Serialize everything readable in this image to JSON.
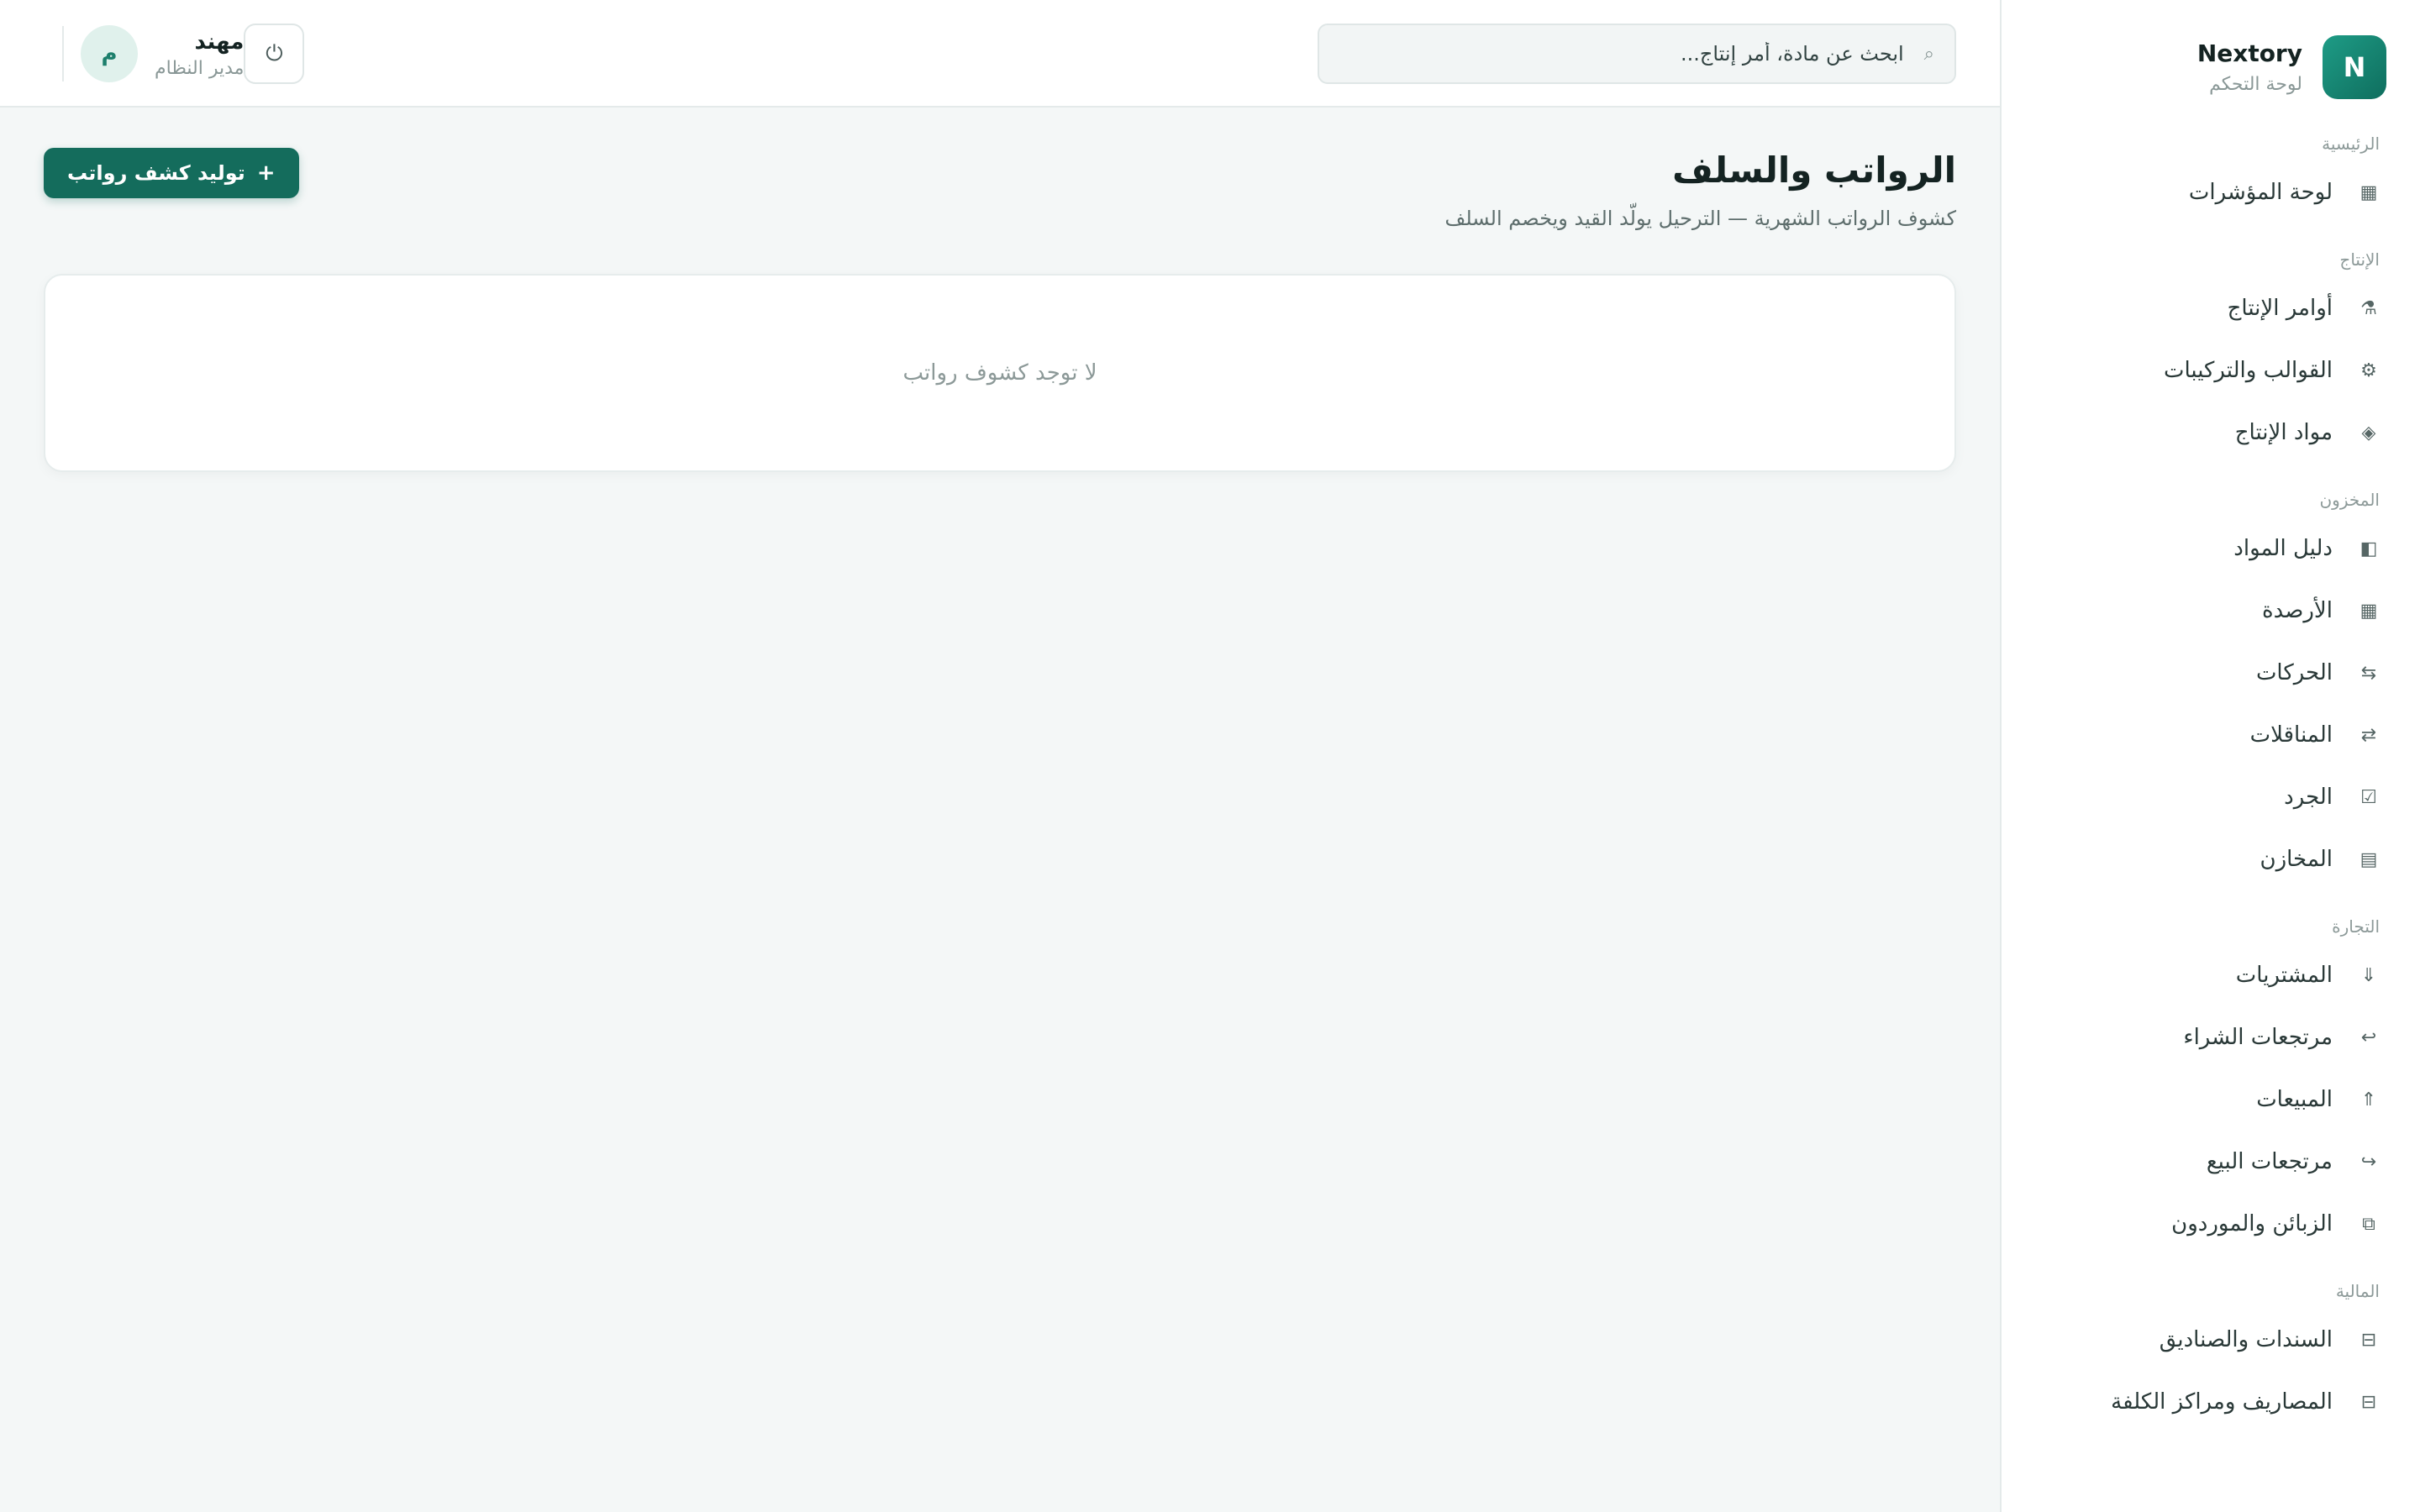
{
  "brand": {
    "logo_letter": "N",
    "name": "Nextory",
    "subtitle": "لوحة التحكم"
  },
  "sidebar": {
    "sections": [
      {
        "title": "الرئيسية",
        "items": [
          {
            "label": "لوحة المؤشرات",
            "icon": "▦",
            "icon_name": "dashboard-grid-icon"
          }
        ]
      },
      {
        "title": "الإنتاج",
        "items": [
          {
            "label": "أوامر الإنتاج",
            "icon": "⚗",
            "icon_name": "production-order-icon"
          },
          {
            "label": "القوالب والتركيبات",
            "icon": "⚙",
            "icon_name": "gear-icon"
          },
          {
            "label": "مواد الإنتاج",
            "icon": "◈",
            "icon_name": "diamond-icon"
          }
        ]
      },
      {
        "title": "المخزون",
        "items": [
          {
            "label": "دليل المواد",
            "icon": "◧",
            "icon_name": "catalog-icon"
          },
          {
            "label": "الأرصدة",
            "icon": "▦",
            "icon_name": "grid-icon"
          },
          {
            "label": "الحركات",
            "icon": "⇆",
            "icon_name": "movements-icon"
          },
          {
            "label": "المناقلات",
            "icon": "⇄",
            "icon_name": "transfer-icon"
          },
          {
            "label": "الجرد",
            "icon": "☑",
            "icon_name": "checkbox-icon"
          },
          {
            "label": "المخازن",
            "icon": "▤",
            "icon_name": "warehouse-icon"
          }
        ]
      },
      {
        "title": "التجارة",
        "items": [
          {
            "label": "المشتريات",
            "icon": "⇓",
            "icon_name": "purchase-arrow-icon"
          },
          {
            "label": "مرتجعات الشراء",
            "icon": "↩",
            "icon_name": "return-arrow-icon"
          },
          {
            "label": "المبيعات",
            "icon": "⇑",
            "icon_name": "sales-arrow-icon"
          },
          {
            "label": "مرتجعات البيع",
            "icon": "↪",
            "icon_name": "sales-return-icon"
          },
          {
            "label": "الزبائن والموردون",
            "icon": "⧉",
            "icon_name": "contacts-icon"
          }
        ]
      },
      {
        "title": "المالية",
        "items": [
          {
            "label": "السندات والصناديق",
            "icon": "⊟",
            "icon_name": "cashbox-icon"
          },
          {
            "label": "المصاريف ومراكز الكلفة",
            "icon": "⊟",
            "icon_name": "expenses-icon"
          }
        ]
      }
    ]
  },
  "search": {
    "placeholder": "ابحث عن مادة، أمر إنتاج..."
  },
  "user": {
    "avatar_letter": "م",
    "name": "مهند",
    "role": "مدير النظام"
  },
  "page": {
    "title": "الرواتب والسلف",
    "subtitle": "كشوف الرواتب الشهرية — الترحيل يولّد القيد ويخصم السلف",
    "primary_button": "توليد كشف رواتب",
    "primary_button_plus": "+",
    "empty_message": "لا توجد كشوف رواتب"
  }
}
